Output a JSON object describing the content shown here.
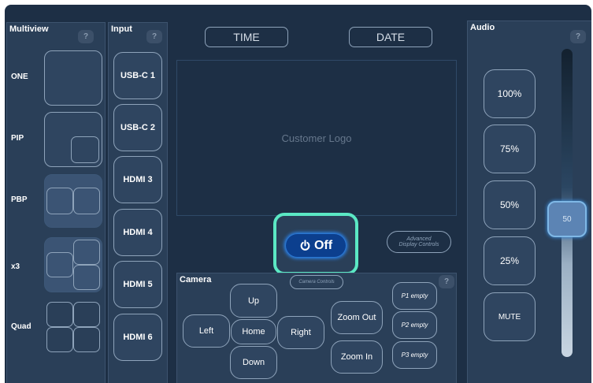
{
  "multiview": {
    "title": "Multiview",
    "help": "?",
    "layouts": [
      {
        "label": "ONE"
      },
      {
        "label": "PIP"
      },
      {
        "label": "PBP"
      },
      {
        "label": "x3"
      },
      {
        "label": "Quad"
      }
    ]
  },
  "input": {
    "title": "Input",
    "help": "?",
    "sources": [
      "USB-C 1",
      "USB-C 2",
      "HDMI 3",
      "HDMI 4",
      "HDMI 5",
      "HDMI 6"
    ]
  },
  "header": {
    "time_label": "TIME",
    "date_label": "DATE"
  },
  "display": {
    "logo_text": "Customer Logo",
    "power_label": "Off",
    "advanced_label_1": "Advanced",
    "advanced_label_2": "Display Controls"
  },
  "camera": {
    "title": "Camera",
    "help": "?",
    "advanced_label": "Camera Controls",
    "up": "Up",
    "left": "Left",
    "home": "Home",
    "right": "Right",
    "down": "Down",
    "zoom_out": "Zoom Out",
    "zoom_in": "Zoom In",
    "presets": [
      "P1 empty",
      "P2 empty",
      "P3 empty"
    ]
  },
  "audio": {
    "title": "Audio",
    "help": "?",
    "levels": [
      "100%",
      "75%",
      "50%",
      "25%"
    ],
    "mute_label": "MUTE",
    "slider_value": "50",
    "slider_level": 50
  },
  "colors": {
    "background": "#1d2f45",
    "panel": "#2a3f58",
    "power_glow": "#5be8c4",
    "power_blue": "#1f6fd6"
  }
}
